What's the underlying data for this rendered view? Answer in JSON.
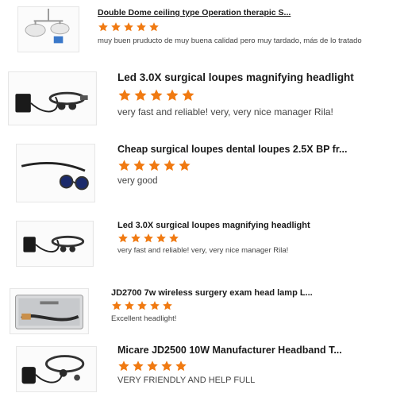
{
  "colors": {
    "star": "#f07a12",
    "title": "#1a1a1a",
    "comment": "#444444"
  },
  "reviews": [
    {
      "title": "Double Dome ceiling type Operation therapic S...",
      "rating": 5,
      "comment": "muy buen pruducto de muy buena calidad pero muy tardado, más de lo tratado",
      "image": "surgical-ceiling-lamp-image"
    },
    {
      "title": "Led 3.0X surgical loupes magnifying headlight",
      "rating": 5,
      "comment": "very fast and reliable! very, very nice manager Rila!",
      "image": "headlight-loupes-image"
    },
    {
      "title": "Cheap surgical loupes dental loupes 2.5X BP fr...",
      "rating": 5,
      "comment": "very good",
      "image": "loupes-image"
    },
    {
      "title": "Led 3.0X surgical loupes magnifying headlight",
      "rating": 5,
      "comment": "very fast and reliable! very, very nice manager Rila!",
      "image": "headlight-loupes-image"
    },
    {
      "title": "JD2700 7w wireless surgery exam head lamp L...",
      "rating": 5,
      "comment": "Excellent headlight!",
      "image": "head-lamp-case-image"
    },
    {
      "title": "Micare JD2500 10W Manufacturer Headband T...",
      "rating": 5,
      "comment": "VERY FRIENDLY AND HELP FULL",
      "image": "headband-lamp-image"
    }
  ]
}
